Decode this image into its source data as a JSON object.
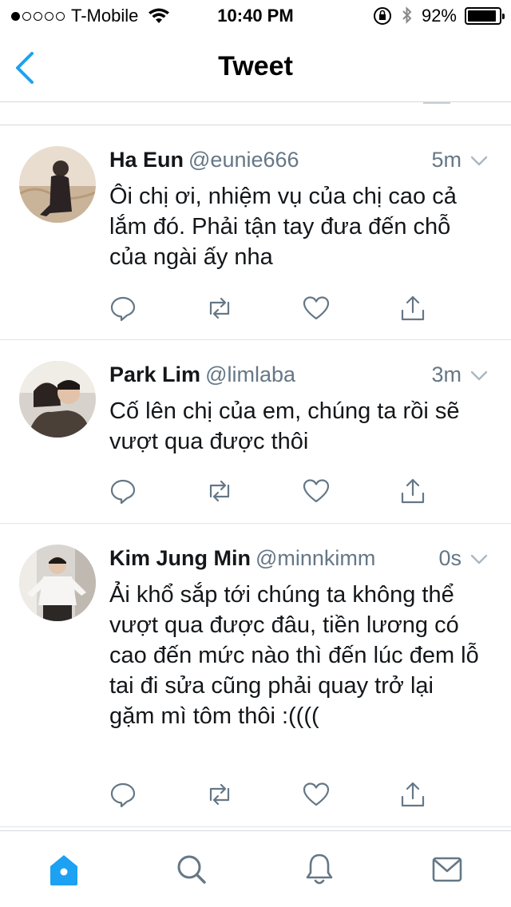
{
  "status_bar": {
    "carrier": "T-Mobile",
    "signal_dots": [
      true,
      false,
      false,
      false,
      false
    ],
    "time": "10:40 PM",
    "battery_percent_label": "92%",
    "battery_level": 0.92
  },
  "nav": {
    "title": "Tweet",
    "back_icon": "chevron-left-icon"
  },
  "tweets": [
    {
      "name": "Ha Eun",
      "handle": "@eunie666",
      "time": "5m",
      "text": "Ôi chị ơi, nhiệm vụ của chị cao cả lắm đó. Phải tận tay đưa đến chỗ của ngài ấy nha"
    },
    {
      "name": "Park Lim",
      "handle": "@limlaba",
      "time": "3m",
      "text": "Cố lên chị của em, chúng ta rồi sẽ vượt qua được thôi"
    },
    {
      "name": "Kim Jung Min",
      "handle": "@minnkimm",
      "time": "0s",
      "text": "Ải khổ sắp tới chúng ta không thể vượt qua được đâu, tiền lương có cao đến mức nào thì đến lúc đem lỗ tai đi sửa cũng phải quay trở lại gặm mì tôm thôi :(((("
    }
  ],
  "tab_bar": {
    "tabs": [
      "home-icon",
      "search-icon",
      "notifications-icon",
      "messages-icon"
    ],
    "active": "home-icon"
  },
  "colors": {
    "accent": "#1da1f2",
    "text": "#14171a",
    "secondary": "#657786",
    "icon": "#657786"
  }
}
